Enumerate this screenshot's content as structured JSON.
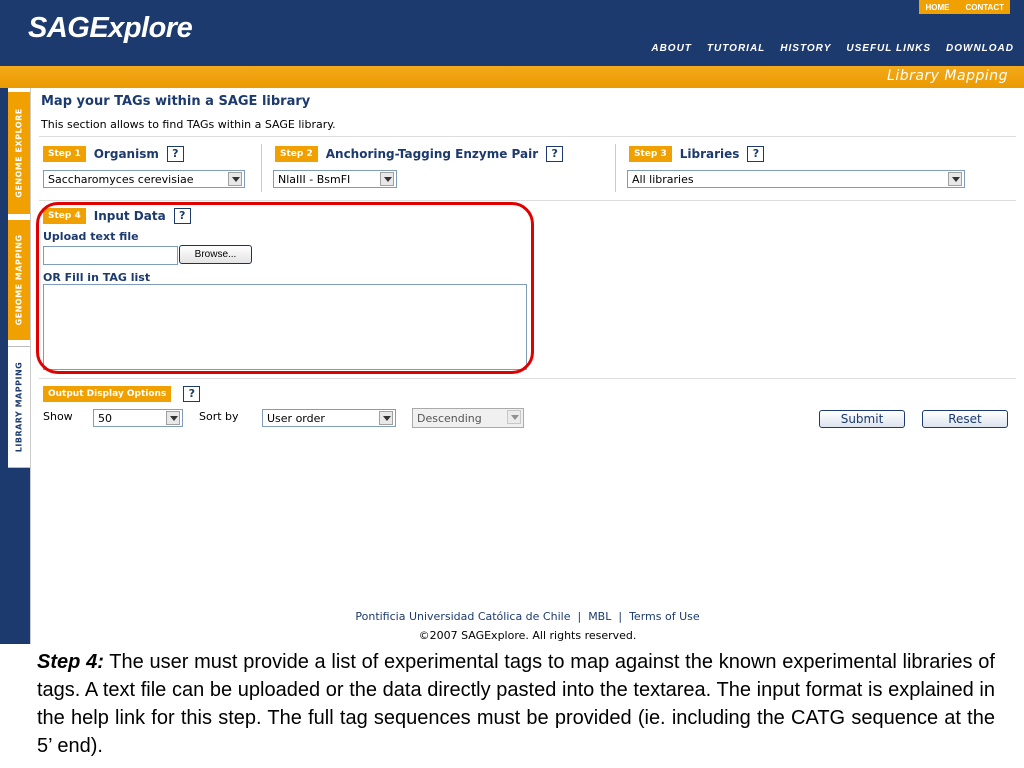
{
  "header": {
    "logo": "SAGExplore",
    "top_links": [
      "HOME",
      "CONTACT"
    ],
    "nav": [
      "ABOUT",
      "TUTORIAL",
      "HISTORY",
      "USEFUL LINKS",
      "DOWNLOAD"
    ]
  },
  "section_title": "Library Mapping",
  "side_tabs": [
    "GENOME EXPLORE",
    "GENOME MAPPING",
    "LIBRARY MAPPING"
  ],
  "page": {
    "title": "Map your TAGs within a SAGE library",
    "description": "This section allows to find TAGs within a SAGE library."
  },
  "steps": [
    {
      "badge": "Step 1",
      "label": "Organism",
      "value": "Saccharomyces cerevisiae"
    },
    {
      "badge": "Step 2",
      "label": "Anchoring-Tagging Enzyme Pair",
      "value": "NlaIII - BsmFI"
    },
    {
      "badge": "Step 3",
      "label": "Libraries",
      "value": "All libraries"
    },
    {
      "badge": "Step 4",
      "label": "Input Data"
    }
  ],
  "help_symbol": "?",
  "input": {
    "upload_label": "Upload text file",
    "browse_label": "Browse...",
    "fill_label": "OR Fill in TAG list"
  },
  "output": {
    "badge": "Output Display Options",
    "show_label": "Show",
    "show_value": "50",
    "sort_label": "Sort by",
    "sort_value": "User order",
    "order_value": "Descending",
    "submit_label": "Submit",
    "reset_label": "Reset"
  },
  "footer": {
    "links": [
      "Pontificia Universidad Católica de Chile",
      "MBL",
      "Terms of Use"
    ],
    "separator": "|",
    "copyright": "©2007 SAGExplore. All rights reserved."
  },
  "caption": {
    "lead": "Step 4:",
    "text": " The user must provide a list of experimental tags to map against the known experimental libraries of tags. A text file can be uploaded or the data directly pasted into the textarea. The input format is explained in the help link for this step. The full tag sequences must be provided (ie. including the CATG sequence at the 5’ end)."
  },
  "colors": {
    "navy": "#1c3a6e",
    "orange": "#f0a000",
    "highlight": "#e00000"
  }
}
